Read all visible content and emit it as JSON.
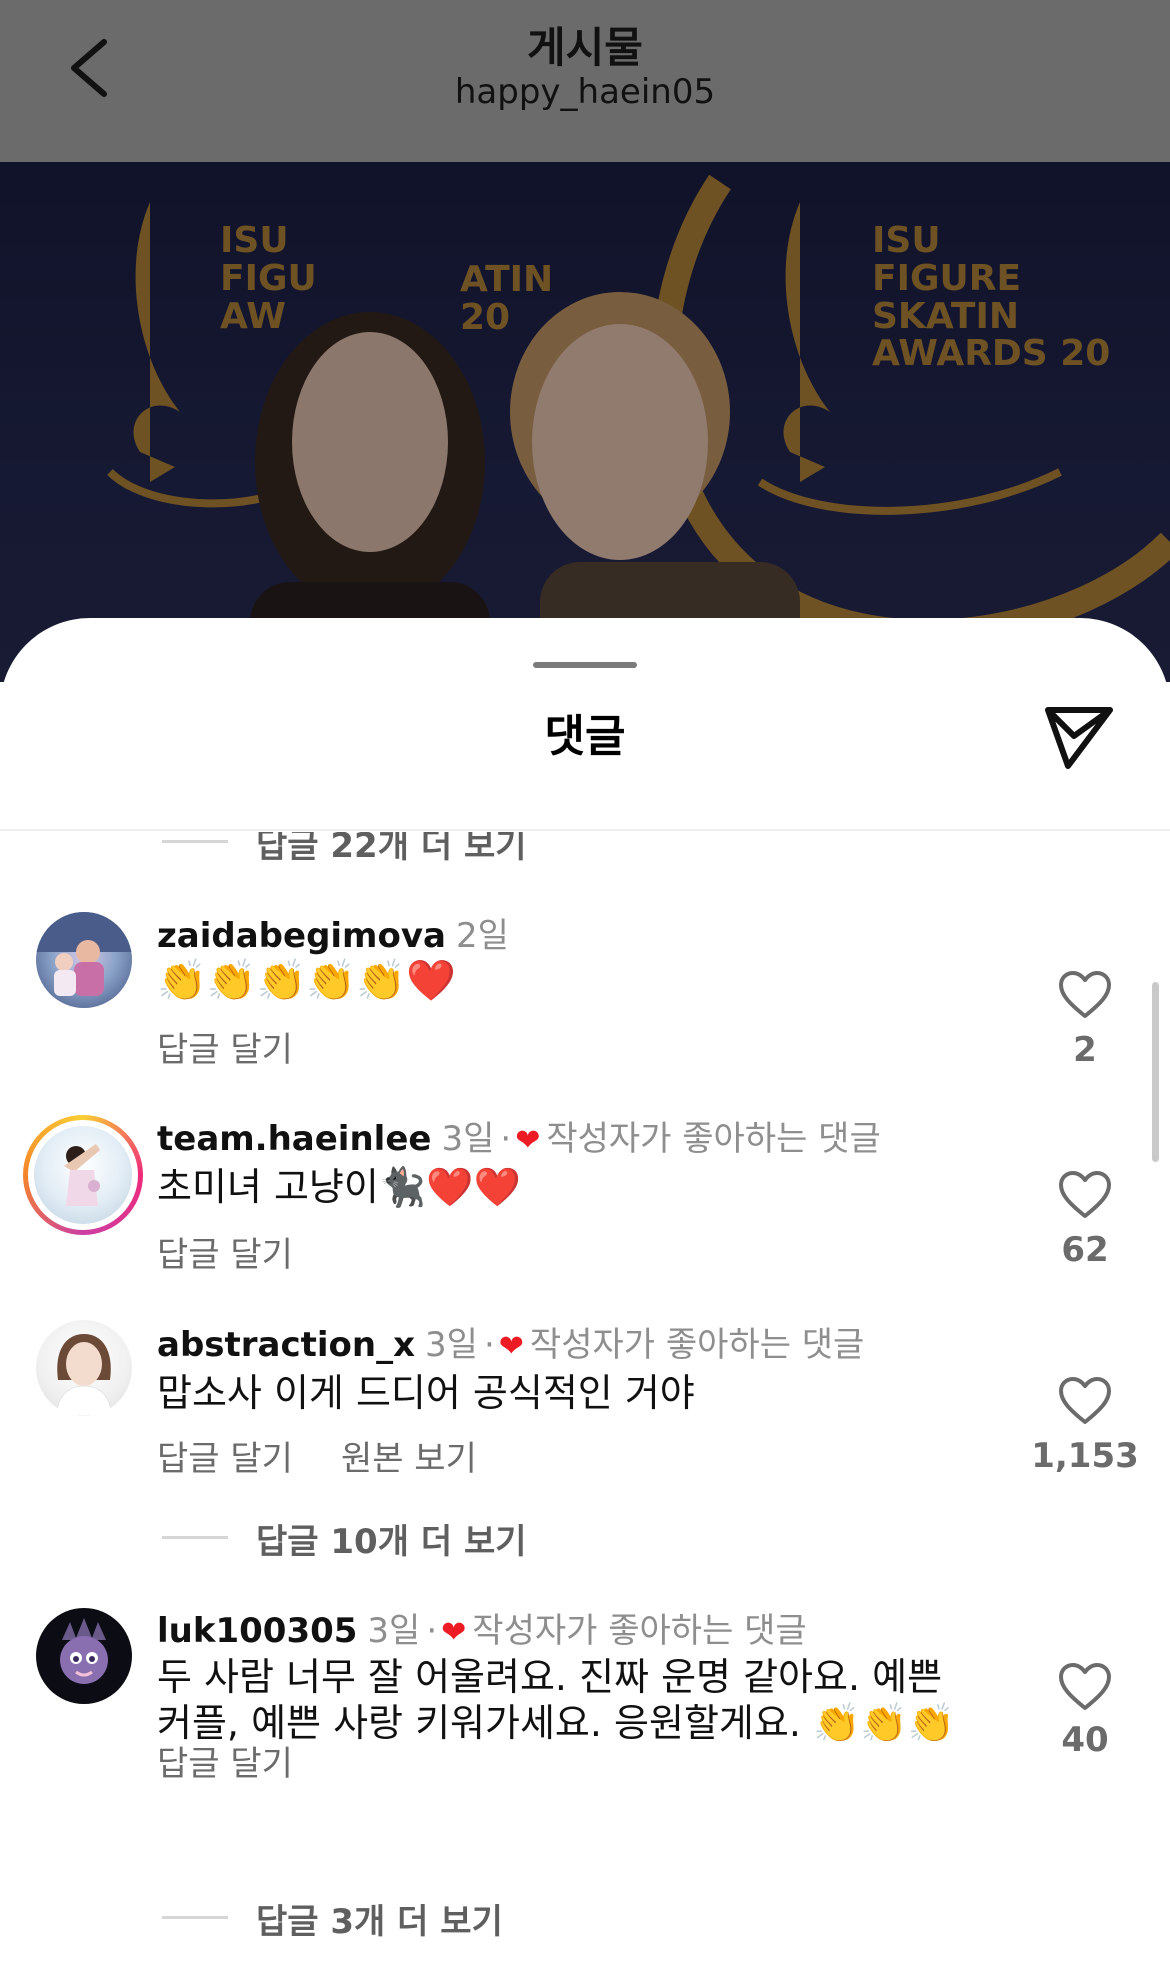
{
  "header": {
    "title": "게시물",
    "username": "happy_haein05"
  },
  "photo": {
    "backdrop_line1": "ISU",
    "backdrop_line2": "FIGURE SKATIN",
    "backdrop_line3": "AWARDS 20",
    "backdrop_left_line2": "FIGU",
    "backdrop_left_line3": "AW",
    "backdrop_mid_line2": "ATIN",
    "backdrop_mid_line3": "20"
  },
  "sheet": {
    "title": "댓글"
  },
  "replies_top": "답글 22개 더 보기",
  "comments": [
    {
      "username": "zaidabegimova",
      "time": "2일",
      "text": "👏👏👏👏👏❤️",
      "reply_label": "답글 달기",
      "likes": "2"
    },
    {
      "username": "team.haeinlee",
      "time": "3일",
      "liked_by_author": "작성자가 좋아하는 댓글",
      "text": "초미녀 고냥이🐈‍⬛❤️❤️",
      "reply_label": "답글 달기",
      "likes": "62"
    },
    {
      "username": "abstraction_x",
      "time": "3일",
      "liked_by_author": "작성자가 좋아하는 댓글",
      "text": "맙소사 이게 드디어 공식적인 거야",
      "reply_label": "답글 달기",
      "original_label": "원본 보기",
      "likes": "1,153",
      "more_replies": "답글 10개 더 보기"
    },
    {
      "username": "luk100305",
      "time": "3일",
      "liked_by_author": "작성자가 좋아하는 댓글",
      "text": "두 사람 너무 잘 어울려요. 진짜 운명 같아요. 예쁜 커플, 예쁜 사랑 키워가세요. 응원할게요. 👏👏👏",
      "reply_label": "답글 달기",
      "likes": "40",
      "more_replies": "답글 3개 더 보기"
    }
  ],
  "colors": {
    "heart_red": "#ed1c24",
    "muted_text": "#8e8e8e",
    "dim_overlay": "#6b6b6b",
    "gold": "#b8893b"
  }
}
